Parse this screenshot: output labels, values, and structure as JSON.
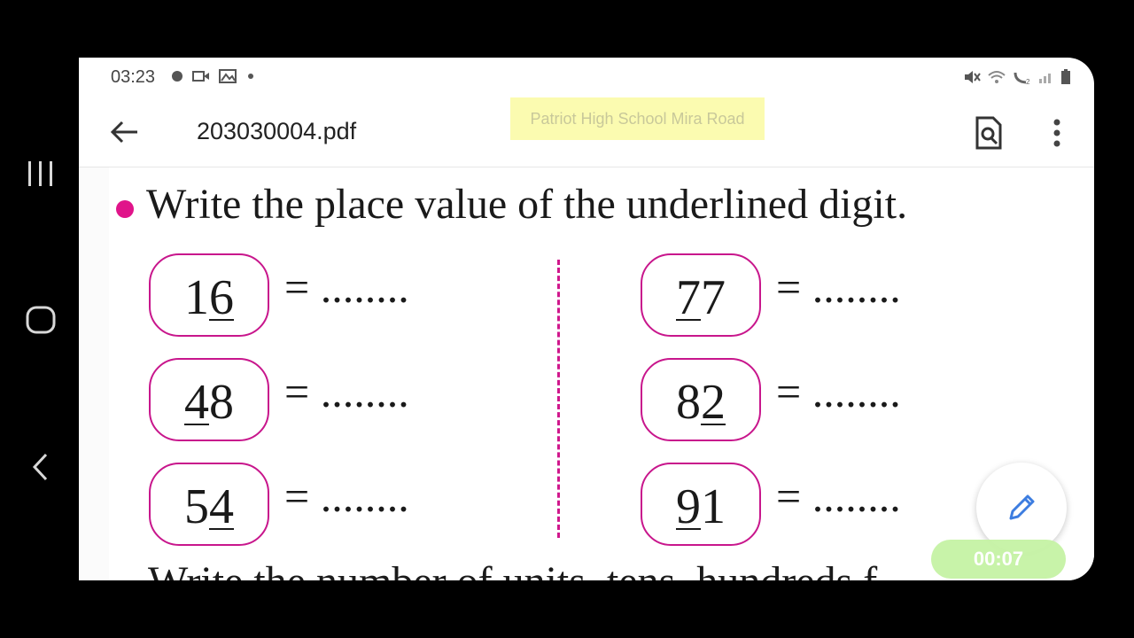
{
  "status_bar": {
    "time": "03:23",
    "left_icons": [
      "record-dot-icon",
      "video-icon",
      "gallery-icon",
      "small-dot-icon"
    ],
    "right_icons": [
      "mute-icon",
      "wifi-icon",
      "wifi-call-icon",
      "signal-icon",
      "battery-icon"
    ]
  },
  "app_bar": {
    "file_name": "203030004.pdf",
    "watermark": "Patriot High School Mira Road"
  },
  "document": {
    "heading": "Write the place value of the underlined digit.",
    "blank": "= ........",
    "left_items": [
      {
        "before": "1",
        "underlined": "6",
        "after": ""
      },
      {
        "before": "",
        "underlined": "4",
        "after": "8"
      },
      {
        "before": "5",
        "underlined": "4",
        "after": ""
      }
    ],
    "right_items": [
      {
        "before": "",
        "underlined": "7",
        "after": "7"
      },
      {
        "before": "8",
        "underlined": "2",
        "after": ""
      },
      {
        "before": "",
        "underlined": "9",
        "after": "1"
      }
    ],
    "next_line_partial": "Write the number of units, tens, hundreds f..."
  },
  "timer": "00:07",
  "colors": {
    "accent_magenta": "#c8168c",
    "watermark_bg": "#fbfbb0",
    "timer_bg": "#c6f3a5",
    "pen_blue": "#3d7de0"
  }
}
